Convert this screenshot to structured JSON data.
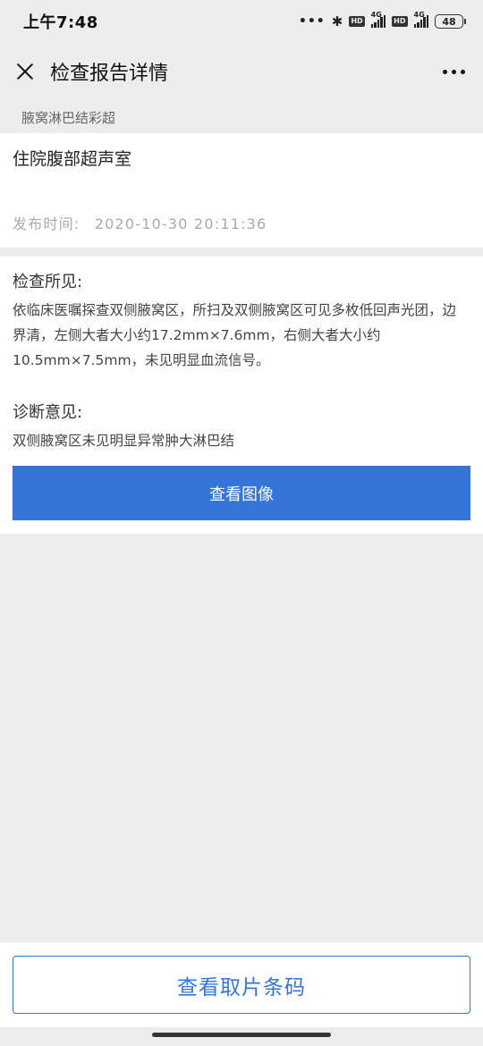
{
  "status_bar": {
    "time": "上午7:48",
    "more": "•••",
    "bluetooth_icon": "bluetooth-icon",
    "hd1": "HD",
    "net1": "4G",
    "hd2": "HD",
    "net2": "4G",
    "battery": "48"
  },
  "nav": {
    "title": "检查报告详情",
    "close_icon": "close-icon",
    "more_icon": "more-icon"
  },
  "category": "腋窝淋巴结彩超",
  "department": {
    "name": "住院腹部超声室",
    "publish_label": "发布时间:",
    "publish_time": "2020-10-30 20:11:36"
  },
  "report": {
    "findings_title": "检查所见:",
    "findings_text": "依临床医嘱探查双侧腋窝区，所扫及双侧腋窝区可见多枚低回声光团，边界清，左侧大者大小约17.2mm×7.6mm，右侧大者大小约10.5mm×7.5mm，未见明显血流信号。",
    "diagnosis_title": "诊断意见:",
    "diagnosis_text": "双侧腋窝区未见明显异常肿大淋巴结",
    "view_image_label": "查看图像"
  },
  "bottom": {
    "barcode_label": "查看取片条码"
  },
  "colors": {
    "accent": "#3575d8",
    "background": "#ededed"
  }
}
